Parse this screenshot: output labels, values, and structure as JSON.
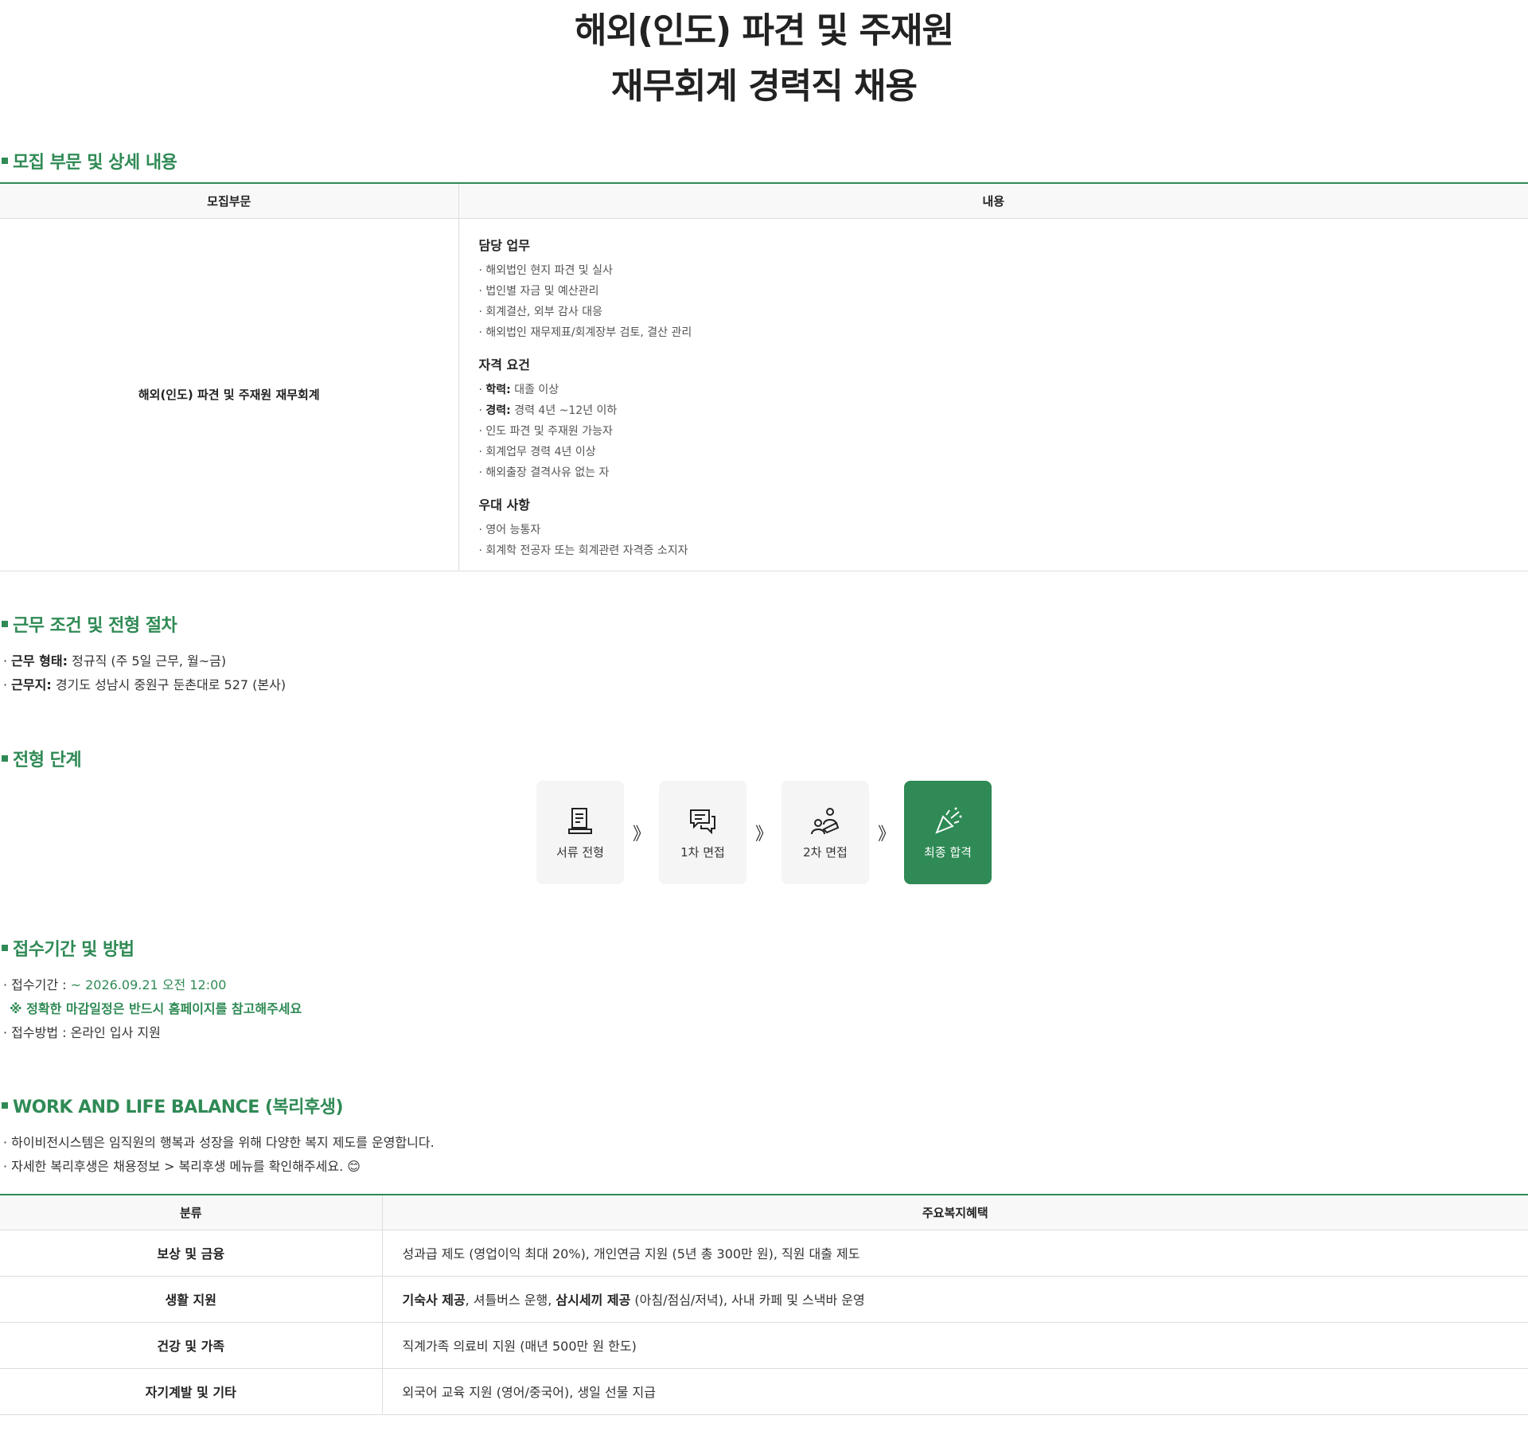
{
  "title": {
    "line1": "해외(인도) 파견 및 주재원",
    "line2": "재무회계 경력직 채용"
  },
  "sections": {
    "recruit": "모집 부문 및 상세 내용",
    "conditions": "근무 조건 및 전형 절차",
    "steps": "전형 단계",
    "apply": "접수기간 및 방법",
    "welfare": "WORK AND LIFE BALANCE (복리후생)"
  },
  "recruit_table": {
    "headers": [
      "모집부문",
      "내용"
    ],
    "part": "해외(인도) 파견 및 주재원 재무회계",
    "duties": {
      "title": "담당 업무",
      "items": [
        "해외법인 현지 파견 및 실사",
        "법인별 자금 및 예산관리",
        "회계결산, 외부 감사 대응",
        "해외법인 재무제표/회계장부 검토, 결산 관리"
      ]
    },
    "qualifications": {
      "title": "자격 요건",
      "items": [
        {
          "label": "학력:",
          "text": "대졸 이상"
        },
        {
          "label": "경력:",
          "text": "경력 4년 ~12년 이하"
        },
        {
          "label": "",
          "text": "인도 파견 및 주재원 가능자"
        },
        {
          "label": "",
          "text": "회계업무 경력 4년 이상"
        },
        {
          "label": "",
          "text": "해외출장 결격사유 없는 자"
        }
      ]
    },
    "preferred": {
      "title": "우대 사항",
      "items": [
        "영어 능통자",
        "회계학 전공자 또는 회계관련 자격증 소지자"
      ]
    }
  },
  "conditions": {
    "type_label": "근무 형태:",
    "type_value": "정규직 (주 5일 근무, 월~금)",
    "location_label": "근무지:",
    "location_value": "경기도 성남시 중원구 둔촌대로 527 (본사)"
  },
  "steps": [
    {
      "label": "서류 전형",
      "icon": "document-icon"
    },
    {
      "label": "1차 면접",
      "icon": "chat-icon"
    },
    {
      "label": "2차 면접",
      "icon": "interview-icon"
    },
    {
      "label": "최종 합격",
      "icon": "celebration-icon"
    }
  ],
  "step_arrow": "》",
  "apply": {
    "period_label": "접수기간 :",
    "period_value": "~ 2026.09.21 오전 12:00",
    "notice": "※ 정확한 마감일정은 반드시 홈페이지를 참고해주세요",
    "method": "접수방법 : 온라인 입사 지원"
  },
  "welfare": {
    "intro1": "하이비전시스템은 임직원의 행복과 성장을 위해 다양한 복지 제도를 운영합니다.",
    "intro2": "자세한 복리후생은 채용정보 > 복리후생 메뉴를 확인해주세요. 😊",
    "headers": [
      "분류",
      "주요복지혜택"
    ],
    "rows": [
      {
        "category": "보상 및 금융",
        "b1": "",
        "t1": "성과급 제도 (영업이익 최대 20%), 개인연금 지원 (5년 총 300만 원), 직원 대출 제도",
        "b2": "",
        "t2": ""
      },
      {
        "category": "생활 지원",
        "b1": "기숙사 제공",
        "t1": ", 셔틀버스 운행, ",
        "b2": "삼시세끼 제공",
        "t2": " (아침/점심/저녁), 사내 카페 및 스낵바 운영"
      },
      {
        "category": "건강 및 가족",
        "b1": "",
        "t1": "직계가족 의료비 지원 (매년 500만 원 한도)",
        "b2": "",
        "t2": ""
      },
      {
        "category": "자기계발 및 기타",
        "b1": "",
        "t1": "외국어 교육 지원 (영어/중국어), 생일 선물 지급",
        "b2": "",
        "t2": ""
      }
    ]
  },
  "colors": {
    "accent": "#2f8a55",
    "border": "#dddddd",
    "header_bg": "#f8f8f8"
  }
}
